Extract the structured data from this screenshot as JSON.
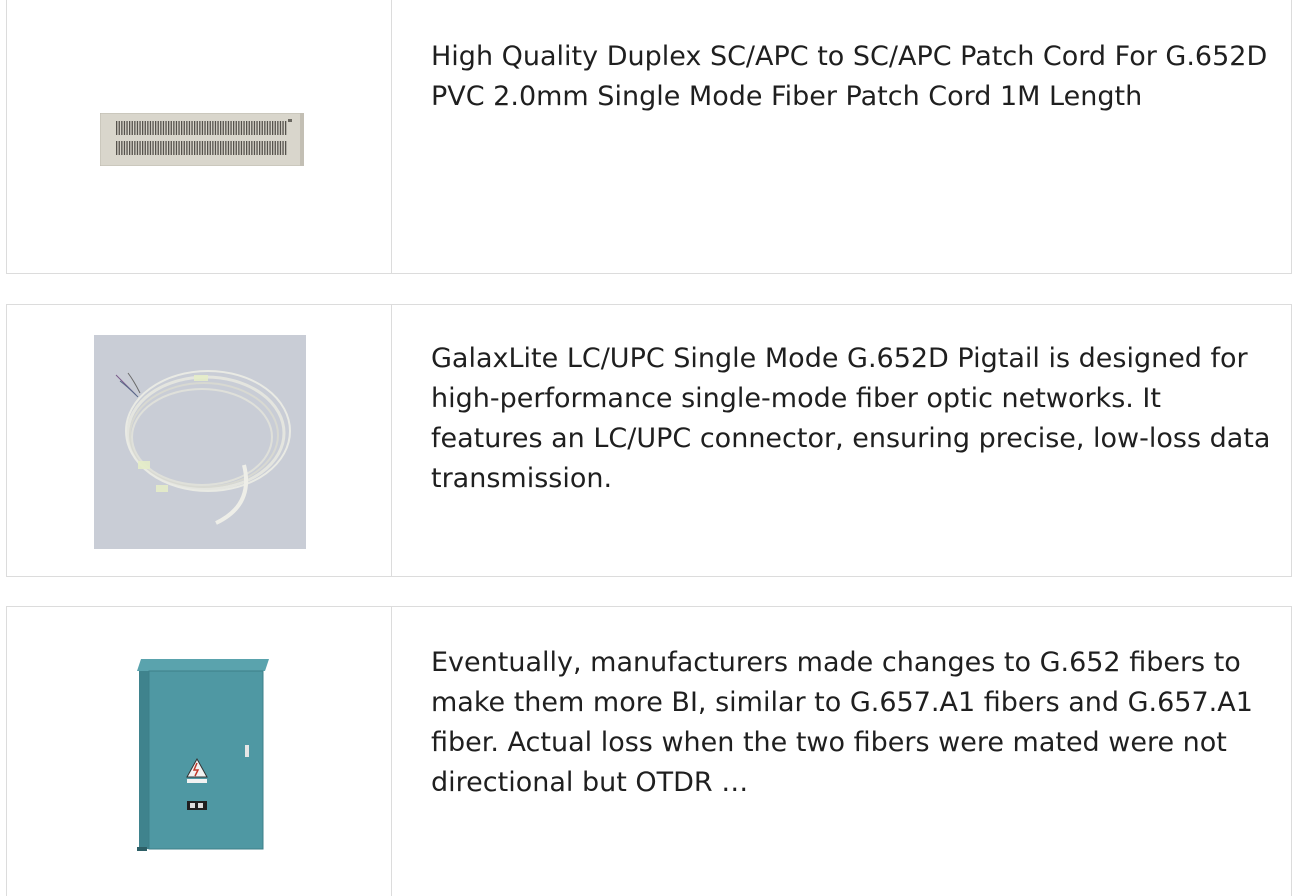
{
  "products": [
    {
      "image_icon": "patch-panel-icon",
      "description": "High Quality Duplex SC/APC to SC/APC Patch Cord For G.652D PVC 2.0mm Single Mode Fiber Patch Cord 1M Length"
    },
    {
      "image_icon": "fiber-pigtail-coil-icon",
      "description": "GalaxLite LC/UPC Single Mode G.652D Pigtail is designed for high-performance single-mode fiber optic networks. It features an LC/UPC connector, ensuring precise, low-loss data transmission."
    },
    {
      "image_icon": "outdoor-cabinet-icon",
      "description": "Eventually, manufacturers made changes to G.652 fibers to make them more BI, similar to G.657.A1 fibers and G.657.A1 fiber. Actual loss when the two fibers were mated were not directional but OTDR …"
    }
  ],
  "colors": {
    "border": "#dcdcdc",
    "text": "#1f1f1f",
    "panel": "#d9d6cc",
    "cabinet": "#4f98a3",
    "photo_bg": "#c9cdd6"
  }
}
